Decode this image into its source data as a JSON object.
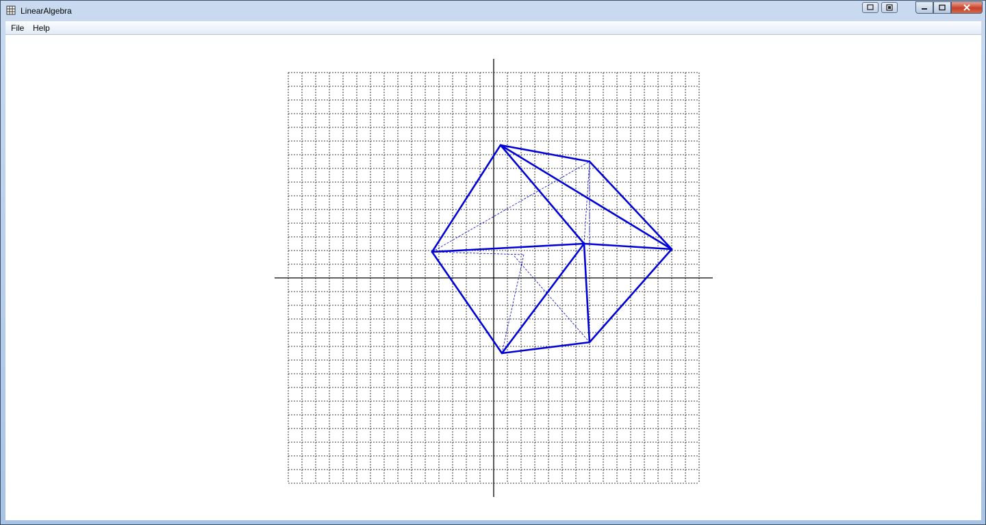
{
  "window": {
    "title": "LinearAlgebra"
  },
  "menu": {
    "items": [
      {
        "label": "File"
      },
      {
        "label": "Help"
      }
    ]
  },
  "icons": {
    "app": "grid-app-icon",
    "minimize": "minimize-icon",
    "maximize": "maximize-icon",
    "close": "close-icon"
  },
  "colors": {
    "shape": "#0000d8",
    "axis": "#000000",
    "grid": "#000000",
    "background": "#ffffff"
  },
  "plot": {
    "grid_range": [
      -15,
      15
    ],
    "grid_step": 1,
    "axes": true,
    "polygons": {
      "outer_hexagon": [
        [
          0.5,
          9.7
        ],
        [
          7,
          8.5
        ],
        [
          13,
          2.1
        ],
        [
          7,
          -4.7
        ],
        [
          0.6,
          -5.5
        ],
        [
          -4.5,
          1.9
        ]
      ],
      "inner_center": [
        6.6,
        2.5
      ]
    }
  }
}
